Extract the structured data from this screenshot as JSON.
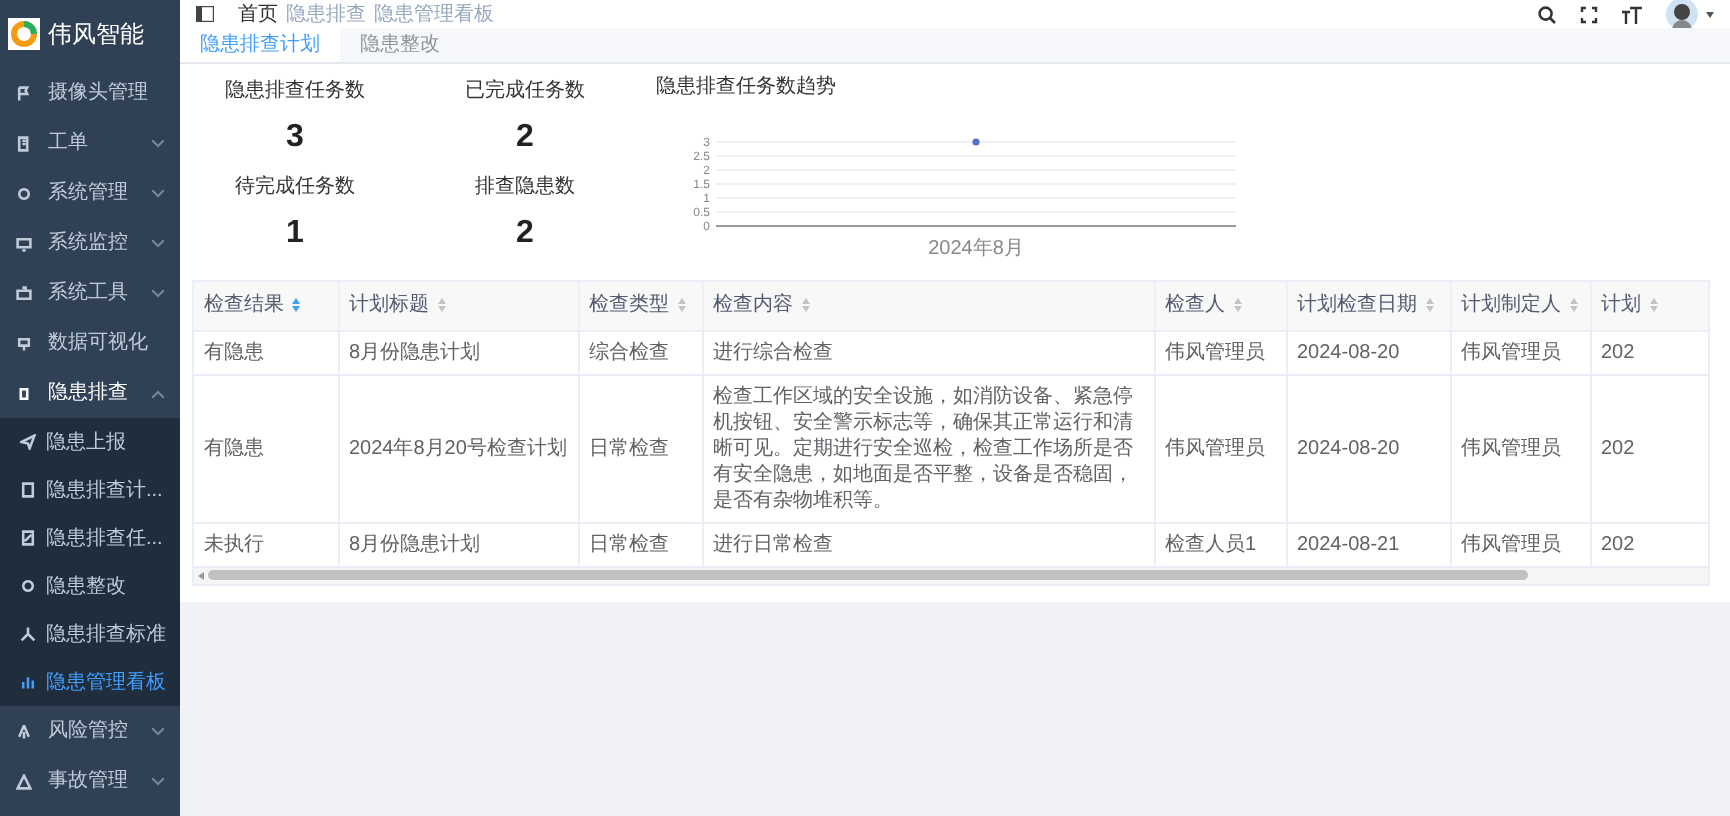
{
  "app": {
    "title": "伟风智能"
  },
  "sidebar": {
    "items": [
      {
        "label": "摄像头管理",
        "expanded": false
      },
      {
        "label": "工单",
        "expanded": false
      },
      {
        "label": "系统管理",
        "expanded": false
      },
      {
        "label": "系统监控",
        "expanded": false
      },
      {
        "label": "系统工具",
        "expanded": false
      },
      {
        "label": "数据可视化",
        "expanded": false
      },
      {
        "label": "隐患排查",
        "expanded": true,
        "children": [
          {
            "label": "隐患上报",
            "selected": false
          },
          {
            "label": "隐患排查计...",
            "selected": false
          },
          {
            "label": "隐患排查任...",
            "selected": false
          },
          {
            "label": "隐患整改",
            "selected": false
          },
          {
            "label": "隐患排查标准",
            "selected": false
          },
          {
            "label": "隐患管理看板",
            "selected": true
          }
        ]
      },
      {
        "label": "风险管控",
        "expanded": false
      },
      {
        "label": "事故管理",
        "expanded": false
      }
    ]
  },
  "breadcrumb": [
    "首页",
    "隐患排查",
    "隐患管理看板"
  ],
  "tabs": [
    {
      "label": "隐患排查计划",
      "selected": true
    },
    {
      "label": "隐患整改",
      "selected": false
    }
  ],
  "stats": [
    {
      "label": "隐患排查任务数",
      "value": "3"
    },
    {
      "label": "已完成任务数",
      "value": "2"
    },
    {
      "label": "待完成任务数",
      "value": "1"
    },
    {
      "label": "排查隐患数",
      "value": "2"
    }
  ],
  "trend": {
    "chart_data": {
      "type": "line",
      "title": "隐患排查任务数趋势",
      "categories": [
        "2024年8月"
      ],
      "series": [
        {
          "color": "#5470c6",
          "values": [
            3
          ],
          "marker": true
        }
      ],
      "grid": true,
      "ylim": [
        0,
        3
      ],
      "yticks": [
        0,
        0.5,
        1,
        1.5,
        2,
        2.5,
        3
      ]
    }
  },
  "table": {
    "columns": [
      {
        "label": "检查结果",
        "sorted": true
      },
      {
        "label": "计划标题",
        "sorted": false
      },
      {
        "label": "检查类型",
        "sorted": false
      },
      {
        "label": "检查内容",
        "sorted": false
      },
      {
        "label": "检查人",
        "sorted": false
      },
      {
        "label": "计划检查日期",
        "sorted": false
      },
      {
        "label": "计划制定人",
        "sorted": false
      },
      {
        "label": "计划",
        "sorted": false
      }
    ],
    "rows": [
      [
        "有隐患",
        "8月份隐患计划",
        "综合检查",
        "进行综合检查",
        "伟风管理员",
        "2024-08-20",
        "伟风管理员",
        "202"
      ],
      [
        "有隐患",
        "2024年8月20号检查计划",
        "日常检查",
        "检查工作区域的安全设施，如消防设备、紧急停机按钮、安全警示标志等，确保其正常运行和清晰可见。定期进行安全巡检，检查工作场所是否有安全隐患，如地面是否平整，设备是否稳固，是否有杂物堆积等。",
        "伟风管理员",
        "2024-08-20",
        "伟风管理员",
        "202"
      ],
      [
        "未执行",
        "8月份隐患计划",
        "日常检查",
        "进行日常检查",
        "检查人员1",
        "2024-08-21",
        "伟风管理员",
        "202"
      ]
    ]
  }
}
